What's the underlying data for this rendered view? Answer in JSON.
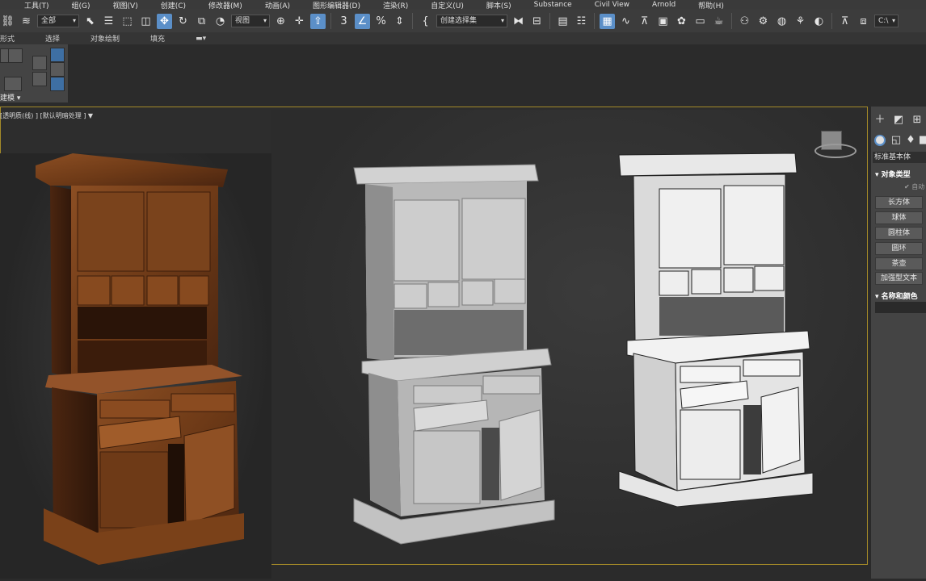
{
  "menu": {
    "items": [
      "工具(T)",
      "组(G)",
      "视图(V)",
      "创建(C)",
      "修改器(M)",
      "动画(A)",
      "图形编辑器(D)",
      "渲染(R)",
      "自定义(U)",
      "脚本(S)",
      "Substance",
      "Civil View",
      "Arnold",
      "帮助(H)"
    ]
  },
  "toolbar": {
    "selection_filter": "全部",
    "reference_coord": "视图",
    "named_selection": "创建选择集",
    "cmd_suffix": "C:\\"
  },
  "ribbon": {
    "tabs": [
      "形式",
      "选择",
      "对象绘制",
      "填充"
    ],
    "panel_label": "建模"
  },
  "viewport": {
    "label": "[透明质(线) ] [默认明暗处理 ]"
  },
  "command_panel": {
    "category": "标准基本体",
    "object_type_header": "对象类型",
    "autogrid_label": "自动",
    "buttons": [
      "长方体",
      "球体",
      "圆柱体",
      "圆环",
      "茶壶",
      "加强型文本"
    ],
    "name_color_header": "名称和颜色"
  }
}
